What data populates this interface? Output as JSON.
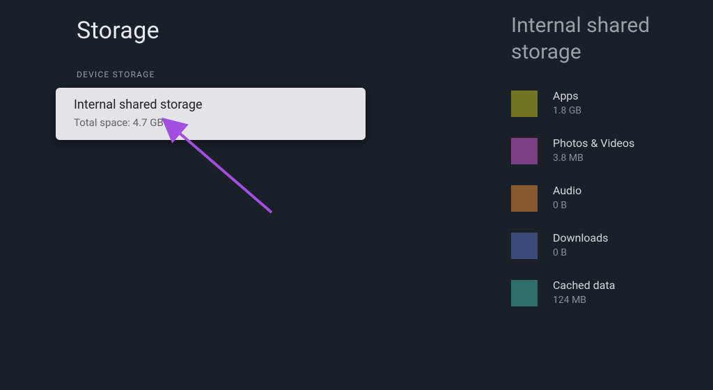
{
  "left": {
    "title": "Storage",
    "section_header": "DEVICE STORAGE",
    "card": {
      "title": "Internal shared storage",
      "subtitle": "Total space: 4.7 GB"
    }
  },
  "right": {
    "title": "Internal shared storage",
    "categories": [
      {
        "label": "Apps",
        "size": "1.8 GB",
        "color": "#6f7521"
      },
      {
        "label": "Photos & Videos",
        "size": "3.8 MB",
        "color": "#7a3f85"
      },
      {
        "label": "Audio",
        "size": "0 B",
        "color": "#8a5a2f"
      },
      {
        "label": "Downloads",
        "size": "0 B",
        "color": "#3a4a78"
      },
      {
        "label": "Cached data",
        "size": "124 MB",
        "color": "#2f6e6a"
      }
    ]
  },
  "annotation": {
    "arrow_color": "#a24fe0"
  }
}
